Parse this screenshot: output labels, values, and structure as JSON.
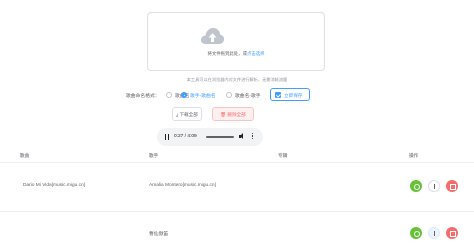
{
  "upload": {
    "icon": "cloud-upload-icon",
    "text_prefix": "将文件拖到此处，或",
    "text_link": "点击选择"
  },
  "tip": "本工具可以在浏览器内对文件进行解析，无需消耗流量",
  "format": {
    "label": "歌曲命名格式：",
    "options": [
      {
        "label": "歌曲名",
        "checked": false
      },
      {
        "label": "歌手-歌曲名",
        "checked": true
      },
      {
        "label": "歌曲名-歌手",
        "checked": false
      }
    ],
    "save_label": "立即保存"
  },
  "buttons": {
    "download_all": "下载全部",
    "delete_all": "删除全部"
  },
  "player": {
    "time": "0:27 / 4:09",
    "progress": 0.11
  },
  "table": {
    "headers": [
      "歌曲",
      "歌手",
      "专辑",
      "操作"
    ],
    "rows": [
      {
        "title": "Dario Mi Vida[music.migu.cn]",
        "artist": "Amalia Montero[music.migu.cn]",
        "album": ""
      },
      {
        "title": "",
        "artist": "曹仙傲笛",
        "album": ""
      }
    ]
  },
  "colors": {
    "primary": "#409eff",
    "success": "#67c23a",
    "danger": "#f56c6c"
  }
}
